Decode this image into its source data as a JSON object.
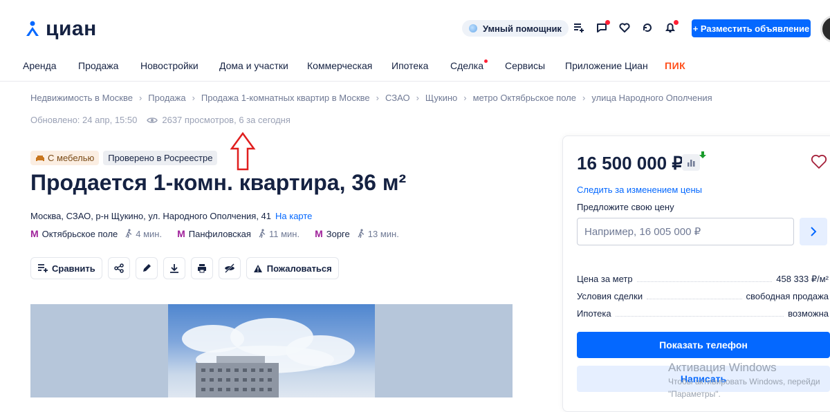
{
  "header": {
    "logo_text": "циан",
    "assistant_label": "Умный помощник",
    "place_ad_label": "+ Разместить объявление"
  },
  "nav": {
    "items": [
      "Аренда",
      "Продажа",
      "Новостройки",
      "Дома и участки",
      "Коммерческая",
      "Ипотека",
      "Сделка",
      "Сервисы",
      "Приложение Циан",
      "ПИК"
    ]
  },
  "breadcrumbs": [
    "Недвижимость в Москве",
    "Продажа",
    "Продажа 1-комнатных квартир в Москве",
    "СЗАО",
    "Щукино",
    "метро Октябрьское поле",
    "улица Народного Ополчения"
  ],
  "meta": {
    "updated": "Обновлено: 24 апр, 15:50",
    "views": "2637 просмотров, 6 за сегодня"
  },
  "badges": {
    "furniture": "С мебелью",
    "verified": "Проверено в Росреестре"
  },
  "title": "Продается 1-комн. квартира, 36 м²",
  "address": {
    "text": "Москва, СЗАО, р-н Щукино, ул. Народного Ополчения, 41",
    "map_link": "На карте"
  },
  "metro": [
    {
      "name": "Октябрьское поле",
      "time": "4 мин."
    },
    {
      "name": "Панфиловская",
      "time": "11 мин."
    },
    {
      "name": "Зорге",
      "time": "13 мин."
    }
  ],
  "metro_color": "#a0239b",
  "actions": {
    "compare": "Сравнить",
    "complain": "Пожаловаться"
  },
  "card": {
    "price": "16 500 000 ₽",
    "follow_price": "Следить за изменением цены",
    "offer_label": "Предложите свою цену",
    "offer_placeholder": "Например, 16 005 000 ₽",
    "rows": [
      {
        "label": "Цена за метр",
        "value": "458 333 ₽/м²"
      },
      {
        "label": "Условия сделки",
        "value": "свободная продажа"
      },
      {
        "label": "Ипотека",
        "value": "возможна"
      }
    ],
    "show_phone": "Показать телефон",
    "write": "Написать"
  },
  "windows_activation": {
    "title": "Активация Windows",
    "line1": "Чтобы активировать Windows, перейди",
    "line2": "\"Параметры\"."
  },
  "accent_color": "#0468ff"
}
